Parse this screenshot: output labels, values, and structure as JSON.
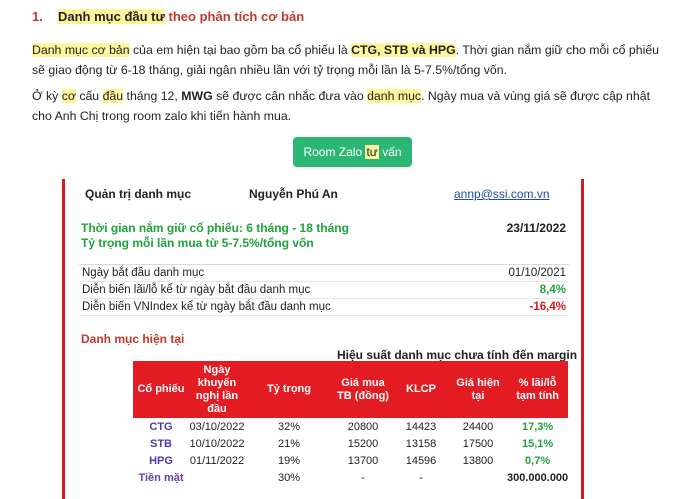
{
  "heading": {
    "number": "1.",
    "hl": "Danh mục đầu tư",
    "rest": " theo phân tích cơ bản"
  },
  "para1": {
    "hl1": "Danh mục cơ bản",
    "t1": " của em hiện tại bao gồm ba cổ phiếu là ",
    "tickers": "CTG, STB và HPG",
    "t2": ". Thời gian nắm giữ cho mỗi cổ phiếu sẽ giao động từ 6-18 tháng, giải ngân nhiều lần với tỷ trọng mỗi lần là 5-7.5%/tổng vốn."
  },
  "para2": {
    "t1": "Ở kỳ ",
    "hl1": "cơ",
    "t2": " cấu ",
    "hl2": "đầu",
    "t3": " tháng 12, ",
    "b1": "MWG",
    "t4": " sẽ được cân nhắc đưa vào ",
    "hl3": "danh mục",
    "t5": ". Ngày mua và vùng giá sẽ được cập nhật cho Anh Chị trong room zalo khi tiến hành mua."
  },
  "button": {
    "pre": "Room Zalo ",
    "hl": "tư",
    "post": " vấn"
  },
  "card": {
    "manager_label": "Quản trị danh mục",
    "manager_name": "Nguyễn Phú An",
    "manager_email": "annp@ssi.com.vn",
    "holding_period": "Thời gian nắm giữ cổ phiếu: 6 tháng - 18 tháng",
    "weight_rule": "Tỷ trọng mỗi lần mua từ 5-7.5%/tổng vốn",
    "report_date": "23/11/2022",
    "stats": [
      {
        "label": "Ngày bắt đầu danh mục",
        "value": "01/10/2021"
      },
      {
        "label": "Diễn biến lãi/lỗ kể từ ngày bắt đầu danh mục",
        "value": "8,4%"
      },
      {
        "label": "Diễn biến VNIndex kể từ ngày bắt đầu danh mục",
        "value": "-16,4%"
      }
    ],
    "section_title": "Danh mục hiện tại",
    "perf_title": "Hiệu suất danh mục chưa tính đến margin",
    "columns": [
      "Cổ phiếu",
      "Ngày khuyến nghị lần đầu",
      "Tỷ trọng",
      "Giá mua TB (đồng)",
      "KLCP",
      "Giá hiện tại",
      "% lãi/lỗ tạm tính"
    ],
    "rows": [
      [
        "CTG",
        "03/10/2022",
        "32%",
        "20800",
        "14423",
        "24400",
        "17,3%"
      ],
      [
        "STB",
        "10/10/2022",
        "21%",
        "15200",
        "13158",
        "17500",
        "15,1%"
      ],
      [
        "HPG",
        "01/11/2022",
        "19%",
        "13700",
        "14596",
        "13800",
        "0,7%"
      ]
    ],
    "cash": [
      "Tiền mặt",
      "",
      "30%",
      "-",
      "-",
      "",
      "300.000.000"
    ]
  },
  "colors": {
    "accent_red": "#d71920",
    "header_red": "#e31b23",
    "green": "#1fa33a",
    "highlight": "#fff59a",
    "button_green": "#2bb673"
  }
}
